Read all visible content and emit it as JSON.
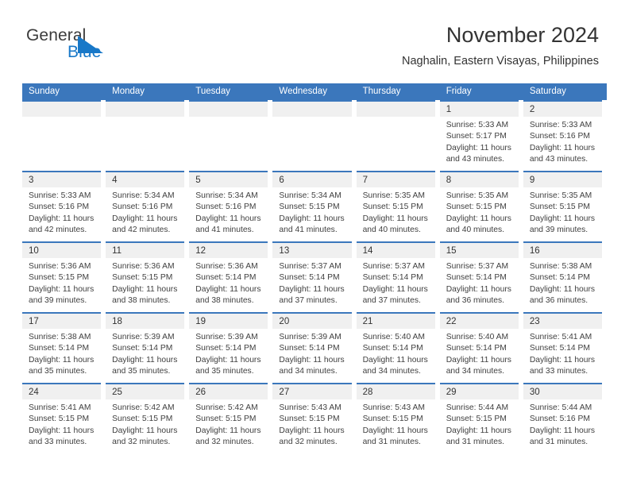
{
  "brand": {
    "name_top": "General",
    "name_bottom": "Blue",
    "top_color": "#3b3b3b",
    "bottom_color": "#1878c8",
    "triangle_color": "#1878c8"
  },
  "header": {
    "title": "November 2024",
    "subtitle": "Naghalin, Eastern Visayas, Philippines"
  },
  "colors": {
    "header_bar": "#3b77bc",
    "week_divider": "#3b77bc",
    "day_band": "#f0f0f0",
    "text": "#404040"
  },
  "weekdays": [
    "Sunday",
    "Monday",
    "Tuesday",
    "Wednesday",
    "Thursday",
    "Friday",
    "Saturday"
  ],
  "weeks": [
    [
      {
        "day": "",
        "lines": [
          "",
          "",
          "",
          ""
        ]
      },
      {
        "day": "",
        "lines": [
          "",
          "",
          "",
          ""
        ]
      },
      {
        "day": "",
        "lines": [
          "",
          "",
          "",
          ""
        ]
      },
      {
        "day": "",
        "lines": [
          "",
          "",
          "",
          ""
        ]
      },
      {
        "day": "",
        "lines": [
          "",
          "",
          "",
          ""
        ]
      },
      {
        "day": "1",
        "lines": [
          "Sunrise: 5:33 AM",
          "Sunset: 5:17 PM",
          "Daylight: 11 hours",
          "and 43 minutes."
        ]
      },
      {
        "day": "2",
        "lines": [
          "Sunrise: 5:33 AM",
          "Sunset: 5:16 PM",
          "Daylight: 11 hours",
          "and 43 minutes."
        ]
      }
    ],
    [
      {
        "day": "3",
        "lines": [
          "Sunrise: 5:33 AM",
          "Sunset: 5:16 PM",
          "Daylight: 11 hours",
          "and 42 minutes."
        ]
      },
      {
        "day": "4",
        "lines": [
          "Sunrise: 5:34 AM",
          "Sunset: 5:16 PM",
          "Daylight: 11 hours",
          "and 42 minutes."
        ]
      },
      {
        "day": "5",
        "lines": [
          "Sunrise: 5:34 AM",
          "Sunset: 5:16 PM",
          "Daylight: 11 hours",
          "and 41 minutes."
        ]
      },
      {
        "day": "6",
        "lines": [
          "Sunrise: 5:34 AM",
          "Sunset: 5:15 PM",
          "Daylight: 11 hours",
          "and 41 minutes."
        ]
      },
      {
        "day": "7",
        "lines": [
          "Sunrise: 5:35 AM",
          "Sunset: 5:15 PM",
          "Daylight: 11 hours",
          "and 40 minutes."
        ]
      },
      {
        "day": "8",
        "lines": [
          "Sunrise: 5:35 AM",
          "Sunset: 5:15 PM",
          "Daylight: 11 hours",
          "and 40 minutes."
        ]
      },
      {
        "day": "9",
        "lines": [
          "Sunrise: 5:35 AM",
          "Sunset: 5:15 PM",
          "Daylight: 11 hours",
          "and 39 minutes."
        ]
      }
    ],
    [
      {
        "day": "10",
        "lines": [
          "Sunrise: 5:36 AM",
          "Sunset: 5:15 PM",
          "Daylight: 11 hours",
          "and 39 minutes."
        ]
      },
      {
        "day": "11",
        "lines": [
          "Sunrise: 5:36 AM",
          "Sunset: 5:15 PM",
          "Daylight: 11 hours",
          "and 38 minutes."
        ]
      },
      {
        "day": "12",
        "lines": [
          "Sunrise: 5:36 AM",
          "Sunset: 5:14 PM",
          "Daylight: 11 hours",
          "and 38 minutes."
        ]
      },
      {
        "day": "13",
        "lines": [
          "Sunrise: 5:37 AM",
          "Sunset: 5:14 PM",
          "Daylight: 11 hours",
          "and 37 minutes."
        ]
      },
      {
        "day": "14",
        "lines": [
          "Sunrise: 5:37 AM",
          "Sunset: 5:14 PM",
          "Daylight: 11 hours",
          "and 37 minutes."
        ]
      },
      {
        "day": "15",
        "lines": [
          "Sunrise: 5:37 AM",
          "Sunset: 5:14 PM",
          "Daylight: 11 hours",
          "and 36 minutes."
        ]
      },
      {
        "day": "16",
        "lines": [
          "Sunrise: 5:38 AM",
          "Sunset: 5:14 PM",
          "Daylight: 11 hours",
          "and 36 minutes."
        ]
      }
    ],
    [
      {
        "day": "17",
        "lines": [
          "Sunrise: 5:38 AM",
          "Sunset: 5:14 PM",
          "Daylight: 11 hours",
          "and 35 minutes."
        ]
      },
      {
        "day": "18",
        "lines": [
          "Sunrise: 5:39 AM",
          "Sunset: 5:14 PM",
          "Daylight: 11 hours",
          "and 35 minutes."
        ]
      },
      {
        "day": "19",
        "lines": [
          "Sunrise: 5:39 AM",
          "Sunset: 5:14 PM",
          "Daylight: 11 hours",
          "and 35 minutes."
        ]
      },
      {
        "day": "20",
        "lines": [
          "Sunrise: 5:39 AM",
          "Sunset: 5:14 PM",
          "Daylight: 11 hours",
          "and 34 minutes."
        ]
      },
      {
        "day": "21",
        "lines": [
          "Sunrise: 5:40 AM",
          "Sunset: 5:14 PM",
          "Daylight: 11 hours",
          "and 34 minutes."
        ]
      },
      {
        "day": "22",
        "lines": [
          "Sunrise: 5:40 AM",
          "Sunset: 5:14 PM",
          "Daylight: 11 hours",
          "and 34 minutes."
        ]
      },
      {
        "day": "23",
        "lines": [
          "Sunrise: 5:41 AM",
          "Sunset: 5:14 PM",
          "Daylight: 11 hours",
          "and 33 minutes."
        ]
      }
    ],
    [
      {
        "day": "24",
        "lines": [
          "Sunrise: 5:41 AM",
          "Sunset: 5:15 PM",
          "Daylight: 11 hours",
          "and 33 minutes."
        ]
      },
      {
        "day": "25",
        "lines": [
          "Sunrise: 5:42 AM",
          "Sunset: 5:15 PM",
          "Daylight: 11 hours",
          "and 32 minutes."
        ]
      },
      {
        "day": "26",
        "lines": [
          "Sunrise: 5:42 AM",
          "Sunset: 5:15 PM",
          "Daylight: 11 hours",
          "and 32 minutes."
        ]
      },
      {
        "day": "27",
        "lines": [
          "Sunrise: 5:43 AM",
          "Sunset: 5:15 PM",
          "Daylight: 11 hours",
          "and 32 minutes."
        ]
      },
      {
        "day": "28",
        "lines": [
          "Sunrise: 5:43 AM",
          "Sunset: 5:15 PM",
          "Daylight: 11 hours",
          "and 31 minutes."
        ]
      },
      {
        "day": "29",
        "lines": [
          "Sunrise: 5:44 AM",
          "Sunset: 5:15 PM",
          "Daylight: 11 hours",
          "and 31 minutes."
        ]
      },
      {
        "day": "30",
        "lines": [
          "Sunrise: 5:44 AM",
          "Sunset: 5:16 PM",
          "Daylight: 11 hours",
          "and 31 minutes."
        ]
      }
    ]
  ]
}
